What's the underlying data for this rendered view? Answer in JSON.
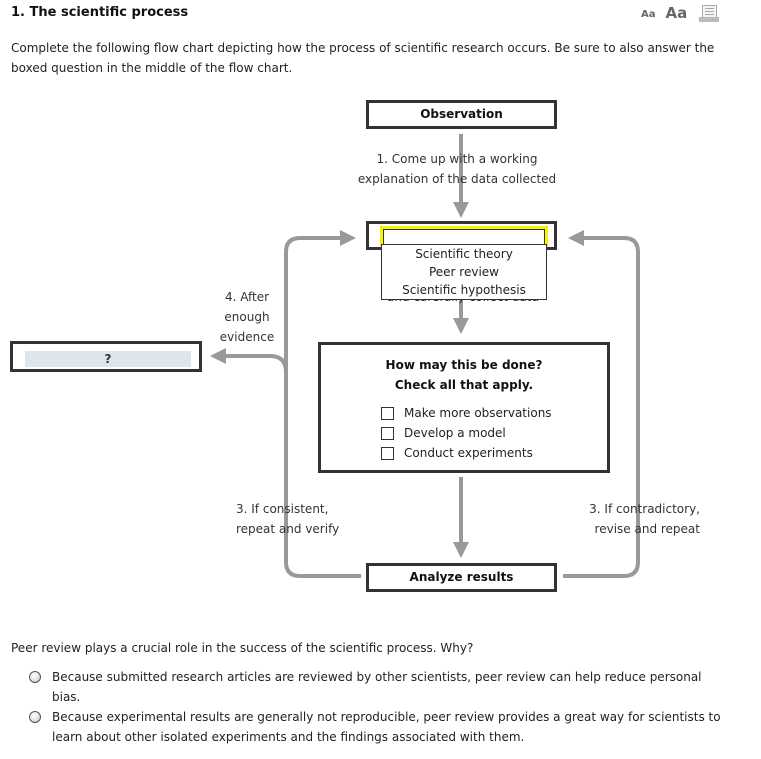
{
  "header": {
    "title": "1.  The scientific process",
    "font_small_label": "Aa",
    "font_large_label": "Aa",
    "print_icon": "print-icon"
  },
  "intro": "Complete the following flow chart depicting how the process of scientific research occurs. Be sure to also answer the boxed question in the middle of the flow chart.",
  "flowchart": {
    "observation": "Observation",
    "step1_line1": "1. Come up with a working",
    "step1_line2": "explanation of the data collected",
    "dropdown": {
      "selected": "",
      "options": [
        "Scientific theory",
        "Peer review",
        "Scientific hypothesis"
      ]
    },
    "hidden_step2_text": "and carefully collect data",
    "question_box": {
      "line1": "How may this be done?",
      "line2": "Check all that apply.",
      "checkboxes": [
        {
          "label": "Make more observations",
          "checked": false
        },
        {
          "label": "Develop a model",
          "checked": false
        },
        {
          "label": "Conduct experiments",
          "checked": false
        }
      ]
    },
    "analyze": "Analyze results",
    "left_label_line1": "3. If consistent,",
    "left_label_line2": "repeat and verify",
    "right_label_line1": "3. If contradictory,",
    "right_label_line2": "revise and repeat",
    "step4_line1": "4. After",
    "step4_line2": "enough",
    "step4_line3": "evidence",
    "unknown_box": "?",
    "colors": {
      "arrow": "#999999",
      "box_border": "#333333",
      "highlight": "#f5f500",
      "unknown_fill": "#dde6ea"
    }
  },
  "peer_review": {
    "question": "Peer review plays a crucial role in the success of the scientific process. Why?",
    "options": [
      "Because submitted research articles are reviewed by other scientists, peer review can help reduce personal bias.",
      "Because experimental results are generally not reproducible, peer review provides a great way for scientists to learn about other isolated experiments and the findings associated with them."
    ]
  }
}
